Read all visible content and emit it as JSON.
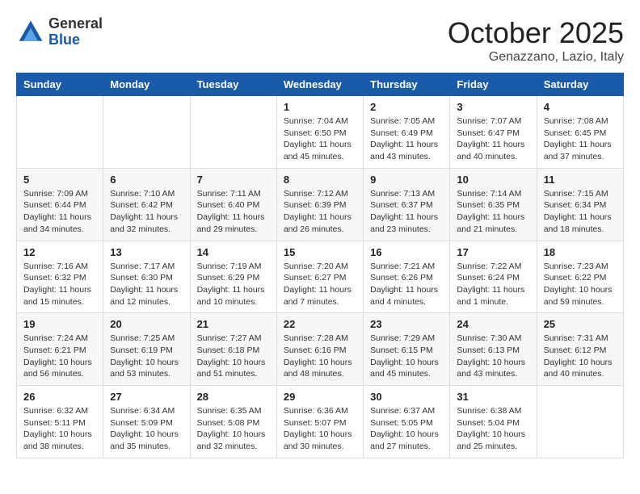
{
  "header": {
    "logo": {
      "general": "General",
      "blue": "Blue"
    },
    "month": "October 2025",
    "location": "Genazzano, Lazio, Italy"
  },
  "days_of_week": [
    "Sunday",
    "Monday",
    "Tuesday",
    "Wednesday",
    "Thursday",
    "Friday",
    "Saturday"
  ],
  "weeks": [
    [
      {
        "day": "",
        "info": ""
      },
      {
        "day": "",
        "info": ""
      },
      {
        "day": "",
        "info": ""
      },
      {
        "day": "1",
        "info": "Sunrise: 7:04 AM\nSunset: 6:50 PM\nDaylight: 11 hours and 45 minutes."
      },
      {
        "day": "2",
        "info": "Sunrise: 7:05 AM\nSunset: 6:49 PM\nDaylight: 11 hours and 43 minutes."
      },
      {
        "day": "3",
        "info": "Sunrise: 7:07 AM\nSunset: 6:47 PM\nDaylight: 11 hours and 40 minutes."
      },
      {
        "day": "4",
        "info": "Sunrise: 7:08 AM\nSunset: 6:45 PM\nDaylight: 11 hours and 37 minutes."
      }
    ],
    [
      {
        "day": "5",
        "info": "Sunrise: 7:09 AM\nSunset: 6:44 PM\nDaylight: 11 hours and 34 minutes."
      },
      {
        "day": "6",
        "info": "Sunrise: 7:10 AM\nSunset: 6:42 PM\nDaylight: 11 hours and 32 minutes."
      },
      {
        "day": "7",
        "info": "Sunrise: 7:11 AM\nSunset: 6:40 PM\nDaylight: 11 hours and 29 minutes."
      },
      {
        "day": "8",
        "info": "Sunrise: 7:12 AM\nSunset: 6:39 PM\nDaylight: 11 hours and 26 minutes."
      },
      {
        "day": "9",
        "info": "Sunrise: 7:13 AM\nSunset: 6:37 PM\nDaylight: 11 hours and 23 minutes."
      },
      {
        "day": "10",
        "info": "Sunrise: 7:14 AM\nSunset: 6:35 PM\nDaylight: 11 hours and 21 minutes."
      },
      {
        "day": "11",
        "info": "Sunrise: 7:15 AM\nSunset: 6:34 PM\nDaylight: 11 hours and 18 minutes."
      }
    ],
    [
      {
        "day": "12",
        "info": "Sunrise: 7:16 AM\nSunset: 6:32 PM\nDaylight: 11 hours and 15 minutes."
      },
      {
        "day": "13",
        "info": "Sunrise: 7:17 AM\nSunset: 6:30 PM\nDaylight: 11 hours and 12 minutes."
      },
      {
        "day": "14",
        "info": "Sunrise: 7:19 AM\nSunset: 6:29 PM\nDaylight: 11 hours and 10 minutes."
      },
      {
        "day": "15",
        "info": "Sunrise: 7:20 AM\nSunset: 6:27 PM\nDaylight: 11 hours and 7 minutes."
      },
      {
        "day": "16",
        "info": "Sunrise: 7:21 AM\nSunset: 6:26 PM\nDaylight: 11 hours and 4 minutes."
      },
      {
        "day": "17",
        "info": "Sunrise: 7:22 AM\nSunset: 6:24 PM\nDaylight: 11 hours and 1 minute."
      },
      {
        "day": "18",
        "info": "Sunrise: 7:23 AM\nSunset: 6:22 PM\nDaylight: 10 hours and 59 minutes."
      }
    ],
    [
      {
        "day": "19",
        "info": "Sunrise: 7:24 AM\nSunset: 6:21 PM\nDaylight: 10 hours and 56 minutes."
      },
      {
        "day": "20",
        "info": "Sunrise: 7:25 AM\nSunset: 6:19 PM\nDaylight: 10 hours and 53 minutes."
      },
      {
        "day": "21",
        "info": "Sunrise: 7:27 AM\nSunset: 6:18 PM\nDaylight: 10 hours and 51 minutes."
      },
      {
        "day": "22",
        "info": "Sunrise: 7:28 AM\nSunset: 6:16 PM\nDaylight: 10 hours and 48 minutes."
      },
      {
        "day": "23",
        "info": "Sunrise: 7:29 AM\nSunset: 6:15 PM\nDaylight: 10 hours and 45 minutes."
      },
      {
        "day": "24",
        "info": "Sunrise: 7:30 AM\nSunset: 6:13 PM\nDaylight: 10 hours and 43 minutes."
      },
      {
        "day": "25",
        "info": "Sunrise: 7:31 AM\nSunset: 6:12 PM\nDaylight: 10 hours and 40 minutes."
      }
    ],
    [
      {
        "day": "26",
        "info": "Sunrise: 6:32 AM\nSunset: 5:11 PM\nDaylight: 10 hours and 38 minutes."
      },
      {
        "day": "27",
        "info": "Sunrise: 6:34 AM\nSunset: 5:09 PM\nDaylight: 10 hours and 35 minutes."
      },
      {
        "day": "28",
        "info": "Sunrise: 6:35 AM\nSunset: 5:08 PM\nDaylight: 10 hours and 32 minutes."
      },
      {
        "day": "29",
        "info": "Sunrise: 6:36 AM\nSunset: 5:07 PM\nDaylight: 10 hours and 30 minutes."
      },
      {
        "day": "30",
        "info": "Sunrise: 6:37 AM\nSunset: 5:05 PM\nDaylight: 10 hours and 27 minutes."
      },
      {
        "day": "31",
        "info": "Sunrise: 6:38 AM\nSunset: 5:04 PM\nDaylight: 10 hours and 25 minutes."
      },
      {
        "day": "",
        "info": ""
      }
    ]
  ]
}
